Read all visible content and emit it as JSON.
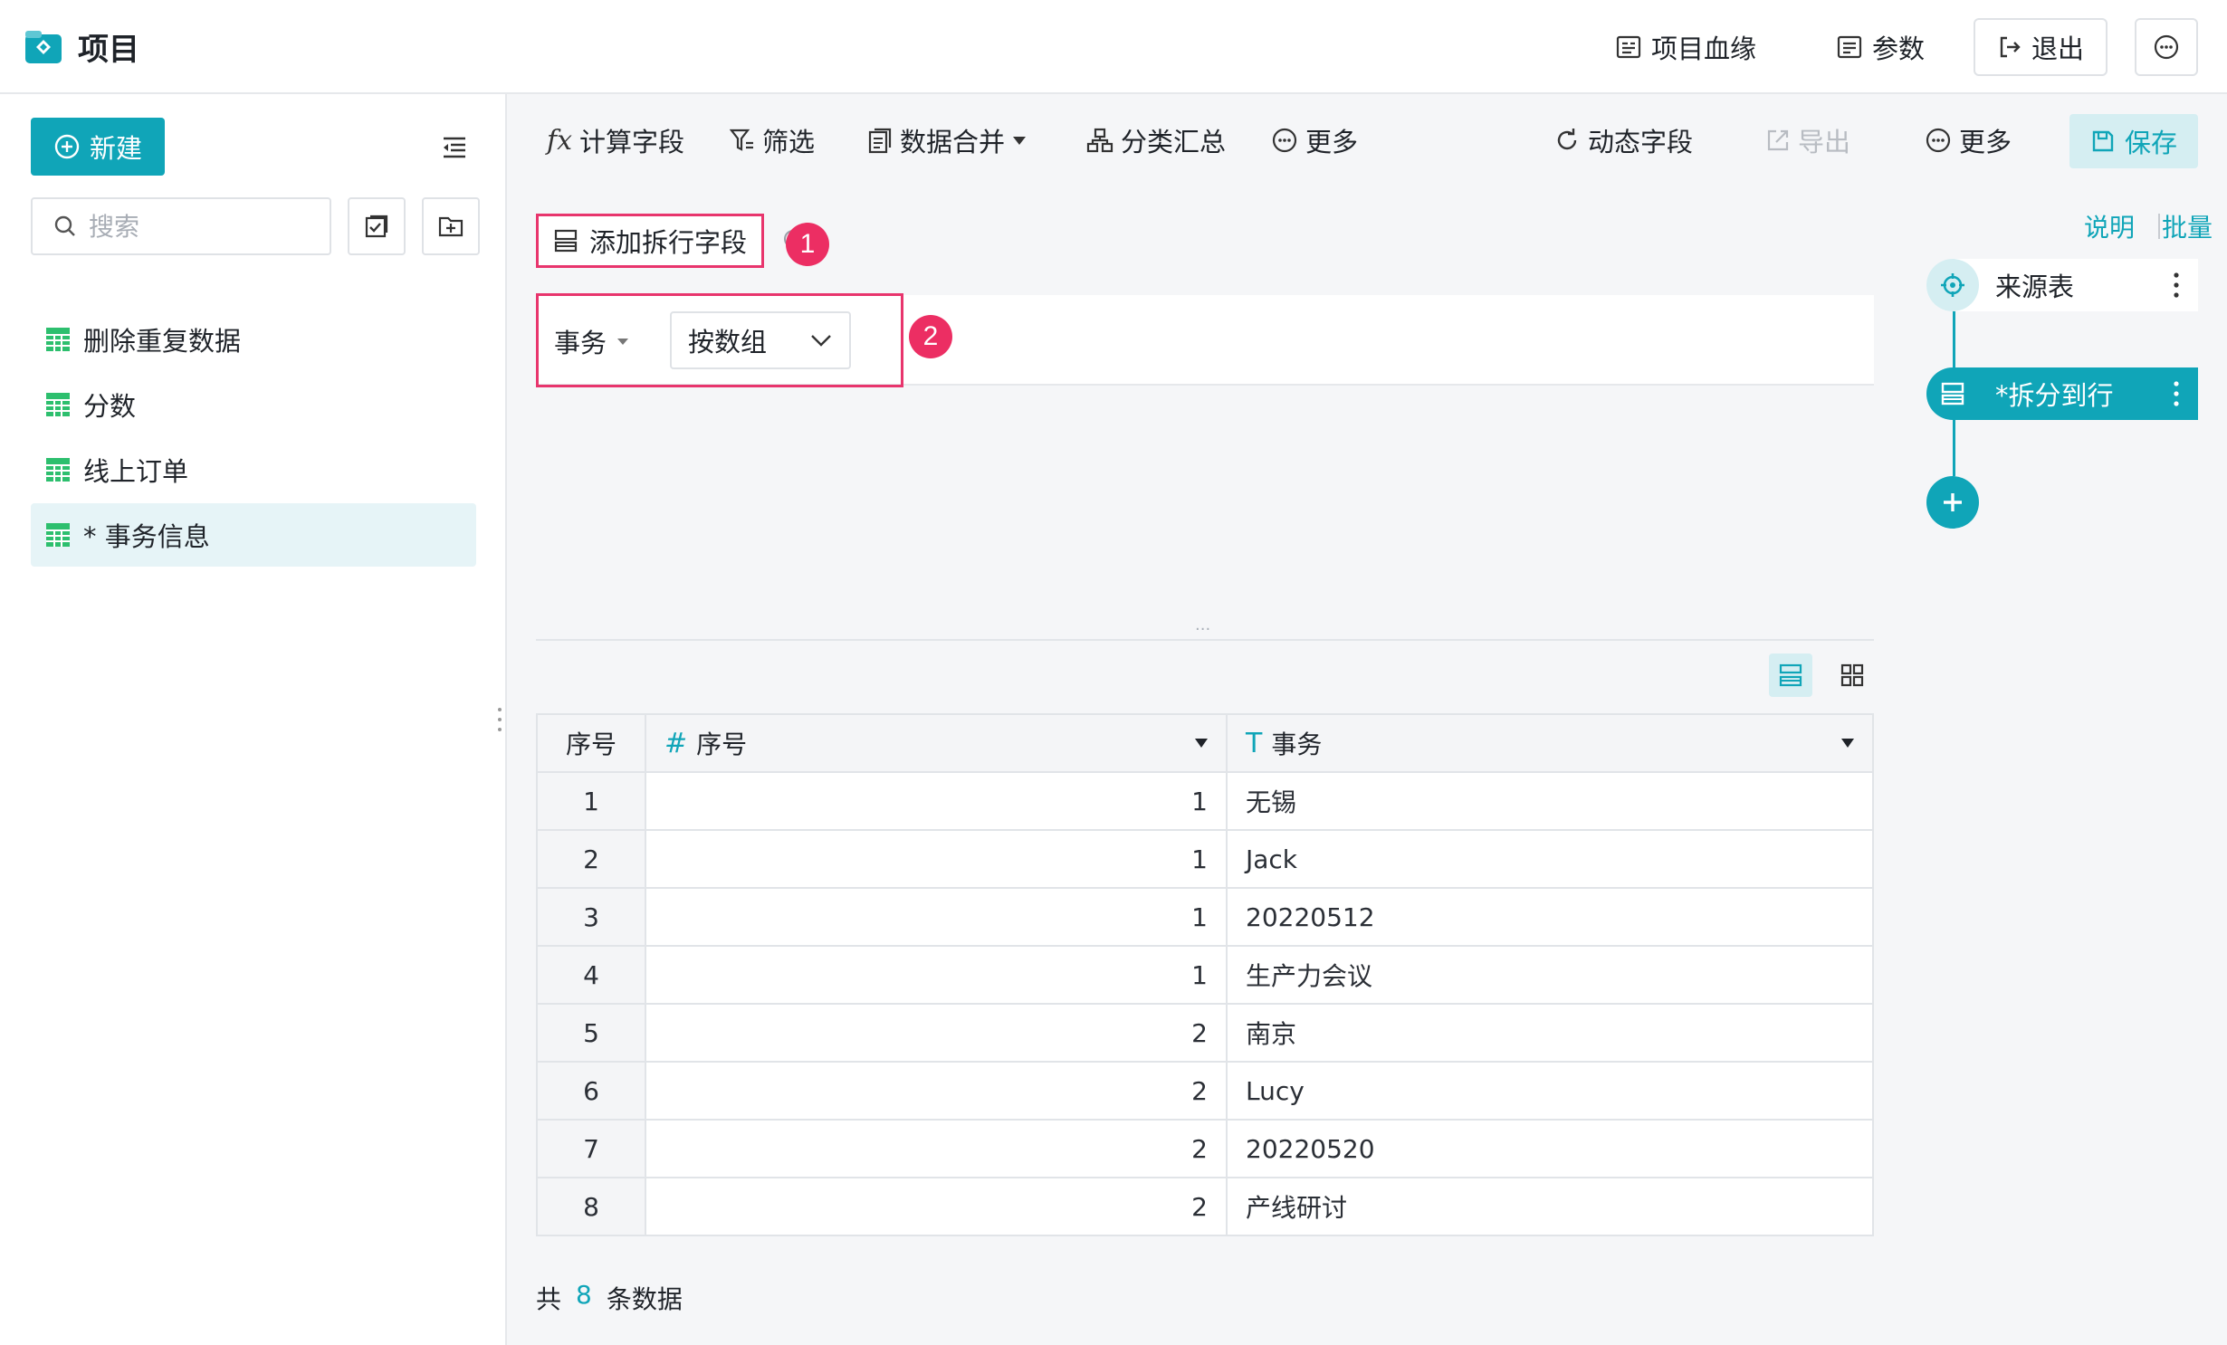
{
  "app": {
    "title": "项目"
  },
  "topbar": {
    "lineage": "项目血缘",
    "params": "参数",
    "exit": "退出"
  },
  "sidebar": {
    "new_label": "新建",
    "search_placeholder": "搜索",
    "items": [
      {
        "label": "删除重复数据"
      },
      {
        "label": "分数"
      },
      {
        "label": "线上订单"
      },
      {
        "label": "* 事务信息"
      }
    ]
  },
  "toolbar": {
    "calc_field": "计算字段",
    "filter": "筛选",
    "merge": "数据合并",
    "group_summary": "分类汇总",
    "more1": "更多",
    "dynamic_field": "动态字段",
    "export": "导出",
    "more2": "更多",
    "save": "保存"
  },
  "config": {
    "add_split_field": "添加拆行字段",
    "badge1": "1",
    "badge2": "2",
    "field_name": "事务",
    "split_mode": "按数组",
    "split_dots": "..."
  },
  "table": {
    "headers": {
      "index": "序号",
      "col1": "序号",
      "col2": "事务"
    },
    "rows": [
      {
        "idx": "1",
        "num": "1",
        "text": "无锡"
      },
      {
        "idx": "2",
        "num": "1",
        "text": "Jack"
      },
      {
        "idx": "3",
        "num": "1",
        "text": "20220512"
      },
      {
        "idx": "4",
        "num": "1",
        "text": "生产力会议"
      },
      {
        "idx": "5",
        "num": "2",
        "text": "南京"
      },
      {
        "idx": "6",
        "num": "2",
        "text": "Lucy"
      },
      {
        "idx": "7",
        "num": "2",
        "text": "20220520"
      },
      {
        "idx": "8",
        "num": "2",
        "text": "产线研讨"
      }
    ],
    "footer": {
      "prefix": "共",
      "count": "8",
      "suffix": "条数据"
    }
  },
  "flow": {
    "desc_link": "说明",
    "batch_link": "批量",
    "source_node": "来源表",
    "split_node": "*拆分到行"
  },
  "colors": {
    "accent": "#10a5b8",
    "highlight": "#e8356d",
    "badge": "#ec2e63"
  }
}
